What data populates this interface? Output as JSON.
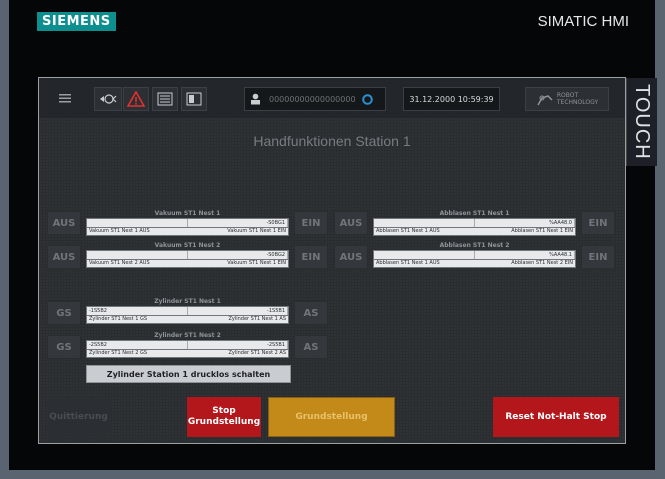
{
  "device": {
    "brand": "SIEMENS",
    "model": "SIMATIC HMI",
    "touch_label": "TOUCH"
  },
  "topbar": {
    "menu_icon": "hamburger-icon",
    "status_id": "00000000000000000",
    "datetime": "31.12.2000 10:59:39",
    "logo_line1": "ROBOT",
    "logo_line2": "TECHNOLOGY"
  },
  "page": {
    "title": "Handfunktionen Station 1"
  },
  "labels": {
    "aus": "AUS",
    "ein": "EIN",
    "gs": "GS",
    "as": "AS"
  },
  "panels": {
    "vakuum1": {
      "title": "Vakuum ST1 Nest 1",
      "value": "-S0BG1",
      "left": "Vakuum ST1 Nest 1 AUS",
      "right": "Vakuum ST1 Nest 1 EIN"
    },
    "vakuum2": {
      "title": "Vakuum ST1 Nest 2",
      "value": "-S0BG2",
      "left": "Vakuum ST1 Nest 2 AUS",
      "right": "Vakuum ST1 Nest 1 EIN"
    },
    "abblasen1": {
      "title": "Abblasen ST1 Nest 1",
      "value": "%AA48.0",
      "left": "Abblasen ST1 Nest 1 AUS",
      "right": "Abblasen ST1 Nest 1 EIN"
    },
    "abblasen2": {
      "title": "Abblasen ST1 Nest 2",
      "value": "%AA48.1",
      "left": "Abblasen ST1 Nest 1 AUS",
      "right": "Abblasen ST1 Nest 2 EIN"
    },
    "zylinder1": {
      "title": "Zylinder ST1 Nest 1",
      "value_left": "-1S5B2",
      "value_right": "-1S5B1",
      "left": "Zylinder ST1 Nest 1 GS",
      "right": "Zylinder ST1 Nest 1 AS"
    },
    "zylinder2": {
      "title": "Zylinder ST1 Nest 2",
      "value_left": "-2S5B2",
      "value_right": "-2S5B1",
      "left": "Zylinder ST1 Nest 2 GS",
      "right": "Zylinder ST1 Nest 2 AS"
    }
  },
  "buttons": {
    "drucklos": "Zylinder Station 1 drucklos schalten",
    "quittierung": "Quittierung",
    "stop_grund_line1": "Stop",
    "stop_grund_line2": "Grundstellung",
    "grundstellung": "Grundstellung",
    "reset": "Reset Not-Halt Stop"
  },
  "colors": {
    "red": "#b3171b",
    "yellow": "#c48a19",
    "teal": "#0e8f8f"
  }
}
